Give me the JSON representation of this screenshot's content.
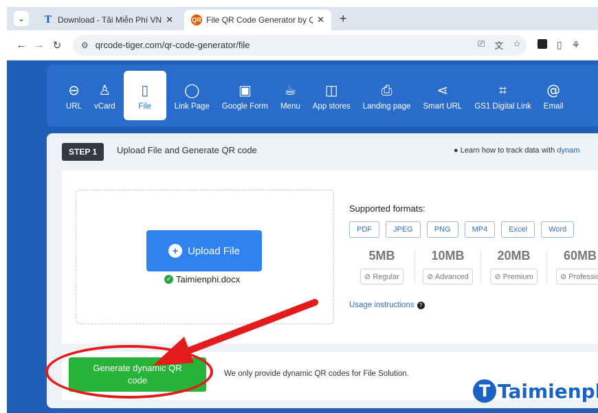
{
  "browser": {
    "tabs": [
      {
        "title": "Download - Tải Miễn Phí VN - P",
        "favicon": "T"
      },
      {
        "title": "File QR Code Generator by QR T",
        "favicon": "QR"
      }
    ],
    "url": "qrcode-tiger.com/qr-code-generator/file"
  },
  "nav": {
    "items": [
      {
        "label": "URL",
        "icon": "link-icon",
        "glyph": "⊖"
      },
      {
        "label": "vCard",
        "icon": "person-icon",
        "glyph": "♙"
      },
      {
        "label": "File",
        "icon": "file-icon",
        "glyph": "🗋"
      },
      {
        "label": "Link Page",
        "icon": "chat-bubble-icon",
        "glyph": "◯"
      },
      {
        "label": "Google Form",
        "icon": "google-form-icon",
        "glyph": "🄶"
      },
      {
        "label": "Menu",
        "icon": "coffee-cup-icon",
        "glyph": "☕"
      },
      {
        "label": "App stores",
        "icon": "store-bag-icon",
        "glyph": "🛍"
      },
      {
        "label": "Landing page",
        "icon": "html-printer-icon",
        "glyph": "⎙"
      },
      {
        "label": "Smart URL",
        "icon": "share-icon",
        "glyph": "⋖"
      },
      {
        "label": "GS1 Digital Link",
        "icon": "gs1-barcode-icon",
        "glyph": "⌗"
      },
      {
        "label": "Email",
        "icon": "at-sign-icon",
        "glyph": "@"
      }
    ],
    "active_index": 2
  },
  "step": {
    "badge": "STEP 1",
    "title": "Upload File and Generate QR code",
    "learn_prefix": "Learn how to track data with",
    "learn_link": "dynam"
  },
  "upload": {
    "button_label": "Upload File",
    "filename": "Taimienphi.docx"
  },
  "formats": {
    "title": "Supported formats:",
    "list": [
      "PDF",
      "JPEG",
      "PNG",
      "MP4",
      "Excel",
      "Word"
    ]
  },
  "plans": [
    {
      "size": "5MB",
      "tier": "Regular"
    },
    {
      "size": "10MB",
      "tier": "Advanced"
    },
    {
      "size": "20MB",
      "tier": "Premium"
    },
    {
      "size": "60MB",
      "tier": "Professio"
    }
  ],
  "usage_label": "Usage instructions",
  "generate_label": "Generate dynamic QR code",
  "note": "We only provide dynamic QR codes for File Solution.",
  "watermark": "Taimienphi"
}
